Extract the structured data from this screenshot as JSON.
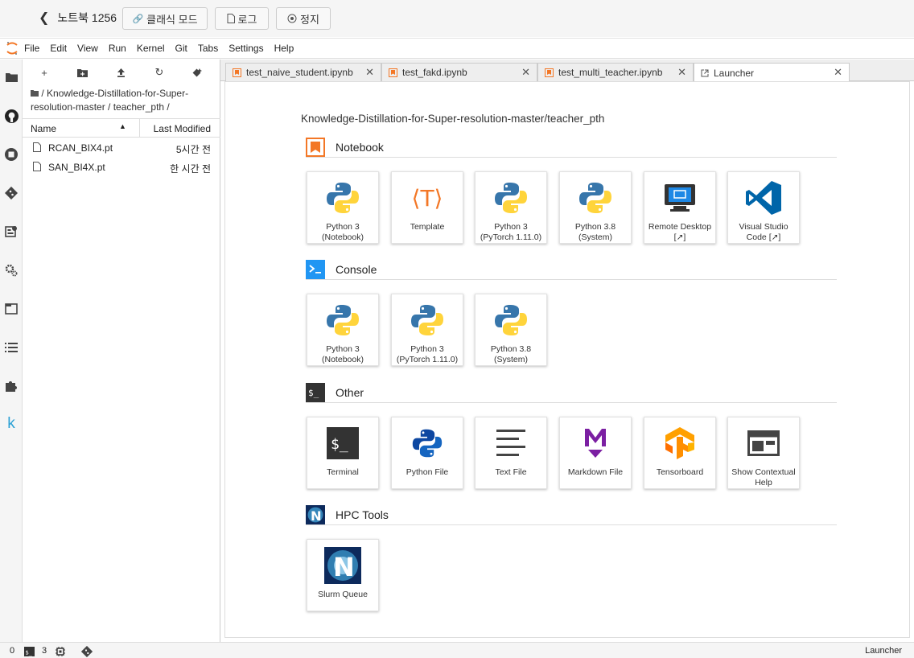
{
  "topbar": {
    "notebook_title": "노트북 1256",
    "classic_mode": "클래식 모드",
    "log": "로그",
    "stop": "정지"
  },
  "menu": [
    "File",
    "Edit",
    "View",
    "Run",
    "Kernel",
    "Git",
    "Tabs",
    "Settings",
    "Help"
  ],
  "sidebar_icons": [
    "folder-icon",
    "github-icon",
    "running-icon",
    "git-icon",
    "property-inspector-icon",
    "extension-settings-icon",
    "tabs-icon",
    "toc-icon",
    "puzzle-icon",
    "k-icon"
  ],
  "filebrowser": {
    "crumbs": "/ Knowledge-Distillation-for-Super-resolution-master / teacher_pth /",
    "col_name": "Name",
    "col_modified": "Last Modified",
    "files": [
      {
        "name": "RCAN_BIX4.pt",
        "modified": "5시간 전"
      },
      {
        "name": "SAN_BI4X.pt",
        "modified": "한 시간 전"
      }
    ]
  },
  "tabs": [
    {
      "label": "test_naive_student.ipynb"
    },
    {
      "label": "test_fakd.ipynb"
    },
    {
      "label": "test_multi_teacher.ipynb"
    },
    {
      "label": "Launcher"
    }
  ],
  "launcher": {
    "path": "Knowledge-Distillation-for-Super-resolution-master/teacher_pth",
    "sections": {
      "notebook": {
        "title": "Notebook",
        "cards": [
          {
            "label": "Python 3\n(Notebook)",
            "icon": "python-icon"
          },
          {
            "label": "Template",
            "icon": "template-icon"
          },
          {
            "label": "Python 3\n(PyTorch 1.11.0)",
            "icon": "python-icon"
          },
          {
            "label": "Python 3.8\n(System)",
            "icon": "python-icon"
          },
          {
            "label": "Remote Desktop\n[↗]",
            "icon": "remote-desktop-icon"
          },
          {
            "label": "Visual Studio\nCode [↗]",
            "icon": "vscode-icon"
          }
        ]
      },
      "console": {
        "title": "Console",
        "cards": [
          {
            "label": "Python 3\n(Notebook)",
            "icon": "python-icon"
          },
          {
            "label": "Python 3\n(PyTorch 1.11.0)",
            "icon": "python-icon"
          },
          {
            "label": "Python 3.8\n(System)",
            "icon": "python-icon"
          }
        ]
      },
      "other": {
        "title": "Other",
        "cards": [
          {
            "label": "Terminal",
            "icon": "terminal-icon"
          },
          {
            "label": "Python File",
            "icon": "python-file-icon"
          },
          {
            "label": "Text File",
            "icon": "text-file-icon"
          },
          {
            "label": "Markdown File",
            "icon": "markdown-icon"
          },
          {
            "label": "Tensorboard",
            "icon": "tensorboard-icon"
          },
          {
            "label": "Show Contextual\nHelp",
            "icon": "help-icon"
          }
        ]
      },
      "hpc": {
        "title": "HPC Tools",
        "cards": [
          {
            "label": "Slurm Queue",
            "icon": "slurm-icon"
          }
        ]
      }
    }
  },
  "statusbar": {
    "count0": "0",
    "count3": "3",
    "mode": "Launcher"
  },
  "colors": {
    "python_blue": "#3776ab",
    "python_yellow": "#ffd43b",
    "notebook_orange": "#f37726",
    "console_blue": "#2196f3",
    "vscode_blue": "#0065a9"
  }
}
